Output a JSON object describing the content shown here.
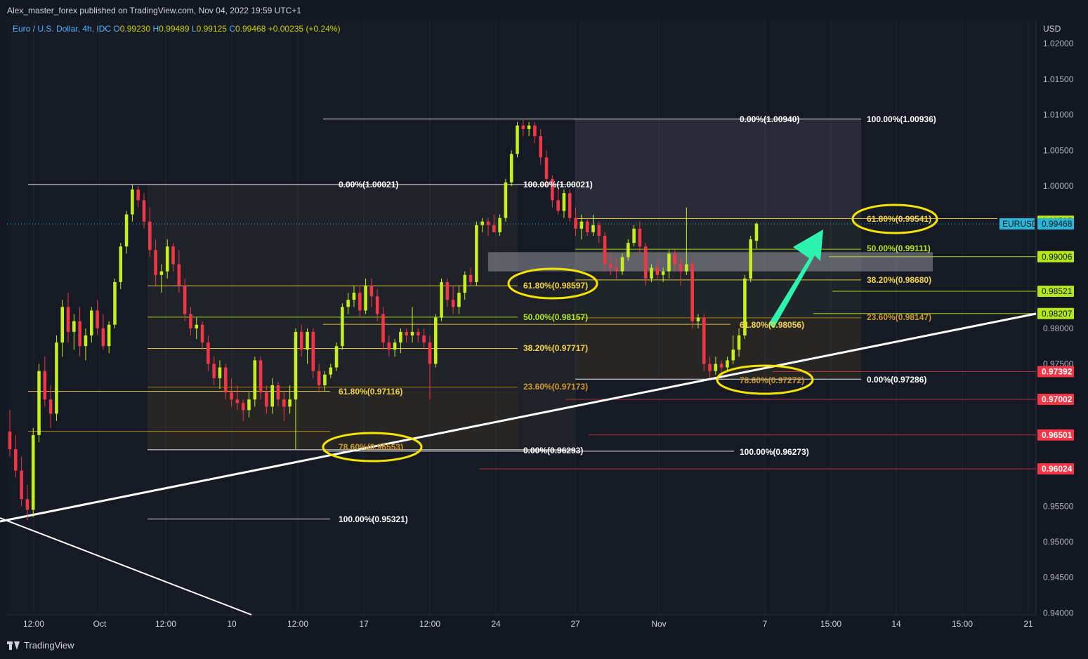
{
  "header": {
    "publisher": "Alex_master_forex published on TradingView.com, Nov 04, 2022 19:59 UTC+1",
    "symbol_desc": "Euro / U.S. Dollar, 4h, IDC",
    "o_label": "O",
    "o_value": "0.99230",
    "h_label": "H",
    "h_value": "0.99489",
    "l_label": "L",
    "l_value": "0.99125",
    "c_label": "C",
    "c_value": "0.99468",
    "change": "+0.00235 (+0.24%)"
  },
  "footer": {
    "brand": "TradingView"
  },
  "colors": {
    "background": "#131722",
    "bull": "#c6ef1f",
    "bear": "#f23645",
    "fib_white": "#ffffff",
    "fib_green": "#b5e61d",
    "fib_yellow": "#f5d442",
    "fib_orange": "#b8860b",
    "ellipse": "#f5e400",
    "arrow": "#2ef2b0",
    "last_price_bg": "#2bb5d6"
  },
  "chart_data": {
    "type": "candlestick",
    "y_axis": {
      "currency": "USD",
      "min": 0.94,
      "max": 1.025,
      "ticks": [
        "1.02000",
        "1.01500",
        "1.01000",
        "1.00500",
        "1.00000",
        "0.98000",
        "0.97500",
        "0.95500",
        "0.95000",
        "0.94500",
        "0.94000"
      ]
    },
    "x_axis": {
      "labels": [
        "12:00",
        "Oct",
        "12:00",
        "10",
        "12:00",
        "17",
        "12:00",
        "24",
        "27",
        "Nov",
        "7",
        "15:00",
        "14",
        "15:00",
        "21"
      ]
    },
    "price_badges": [
      {
        "value": "0.99505",
        "color": "green"
      },
      {
        "value": "0.99468",
        "color": "blue",
        "tag": "EURUSD"
      },
      {
        "value": "0.99006",
        "color": "green"
      },
      {
        "value": "0.98521",
        "color": "green"
      },
      {
        "value": "0.98207",
        "color": "green"
      },
      {
        "value": "0.97392",
        "color": "red"
      },
      {
        "value": "0.97002",
        "color": "red"
      },
      {
        "value": "0.96501",
        "color": "red"
      },
      {
        "value": "0.96024",
        "color": "red"
      }
    ],
    "fib_labels": [
      {
        "text": "0.00%(1.00021)",
        "color": "white"
      },
      {
        "text": "100.00%(1.00021)",
        "color": "white"
      },
      {
        "text": "61.80%(0.97116)",
        "color": "yellow"
      },
      {
        "text": "78.60%(0.96553)",
        "color": "orange"
      },
      {
        "text": "100.00%(0.95321)",
        "color": "white"
      },
      {
        "text": "61.80%(0.98597)",
        "color": "yellow"
      },
      {
        "text": "50.00%(0.98157)",
        "color": "green"
      },
      {
        "text": "38.20%(0.97717)",
        "color": "yellow"
      },
      {
        "text": "23.60%(0.97173)",
        "color": "orange"
      },
      {
        "text": "0.00%(0.96293)",
        "color": "white"
      },
      {
        "text": "0.00%(1.00940)",
        "color": "white"
      },
      {
        "text": "100.00%(1.00936)",
        "color": "white"
      },
      {
        "text": "61.80%(0.99541)",
        "color": "yellow"
      },
      {
        "text": "50.00%(0.99111)",
        "color": "green"
      },
      {
        "text": "38.20%(0.98680)",
        "color": "yellow"
      },
      {
        "text": "23.60%(0.98147)",
        "color": "orange"
      },
      {
        "text": "61.80%(0.98056)",
        "color": "yellow"
      },
      {
        "text": "78.60%(0.97272)",
        "color": "orange"
      },
      {
        "text": "0.00%(0.97286)",
        "color": "white"
      },
      {
        "text": "100.00%(0.96273)",
        "color": "white"
      }
    ],
    "candles": [
      {
        "o": 0.9655,
        "h": 0.9685,
        "l": 0.962,
        "c": 0.963
      },
      {
        "o": 0.963,
        "h": 0.965,
        "l": 0.959,
        "c": 0.96
      },
      {
        "o": 0.96,
        "h": 0.962,
        "l": 0.955,
        "c": 0.956
      },
      {
        "o": 0.956,
        "h": 0.958,
        "l": 0.953,
        "c": 0.9545
      },
      {
        "o": 0.9545,
        "h": 0.966,
        "l": 0.9535,
        "c": 0.965
      },
      {
        "o": 0.965,
        "h": 0.975,
        "l": 0.964,
        "c": 0.974
      },
      {
        "o": 0.974,
        "h": 0.976,
        "l": 0.969,
        "c": 0.97
      },
      {
        "o": 0.97,
        "h": 0.972,
        "l": 0.966,
        "c": 0.968
      },
      {
        "o": 0.968,
        "h": 0.979,
        "l": 0.967,
        "c": 0.978
      },
      {
        "o": 0.978,
        "h": 0.984,
        "l": 0.976,
        "c": 0.983
      },
      {
        "o": 0.983,
        "h": 0.985,
        "l": 0.978,
        "c": 0.9795
      },
      {
        "o": 0.9795,
        "h": 0.982,
        "l": 0.977,
        "c": 0.981
      },
      {
        "o": 0.981,
        "h": 0.983,
        "l": 0.976,
        "c": 0.9775
      },
      {
        "o": 0.9775,
        "h": 0.98,
        "l": 0.9755,
        "c": 0.979
      },
      {
        "o": 0.979,
        "h": 0.983,
        "l": 0.978,
        "c": 0.9825
      },
      {
        "o": 0.9825,
        "h": 0.984,
        "l": 0.979,
        "c": 0.98
      },
      {
        "o": 0.98,
        "h": 0.982,
        "l": 0.977,
        "c": 0.9775
      },
      {
        "o": 0.9775,
        "h": 0.981,
        "l": 0.9765,
        "c": 0.9805
      },
      {
        "o": 0.9805,
        "h": 0.987,
        "l": 0.98,
        "c": 0.9865
      },
      {
        "o": 0.9865,
        "h": 0.992,
        "l": 0.9855,
        "c": 0.9915
      },
      {
        "o": 0.9915,
        "h": 0.9965,
        "l": 0.9905,
        "c": 0.996
      },
      {
        "o": 0.996,
        "h": 1.0002,
        "l": 0.995,
        "c": 0.9995
      },
      {
        "o": 0.9995,
        "h": 1.0,
        "l": 0.997,
        "c": 0.998
      },
      {
        "o": 0.998,
        "h": 0.999,
        "l": 0.994,
        "c": 0.995
      },
      {
        "o": 0.995,
        "h": 0.997,
        "l": 0.99,
        "c": 0.991
      },
      {
        "o": 0.991,
        "h": 0.9925,
        "l": 0.986,
        "c": 0.9875
      },
      {
        "o": 0.9875,
        "h": 0.989,
        "l": 0.985,
        "c": 0.988
      },
      {
        "o": 0.988,
        "h": 0.9925,
        "l": 0.987,
        "c": 0.9915
      },
      {
        "o": 0.9915,
        "h": 0.992,
        "l": 0.988,
        "c": 0.989
      },
      {
        "o": 0.989,
        "h": 0.991,
        "l": 0.985,
        "c": 0.986
      },
      {
        "o": 0.986,
        "h": 0.987,
        "l": 0.981,
        "c": 0.982
      },
      {
        "o": 0.982,
        "h": 0.983,
        "l": 0.979,
        "c": 0.98
      },
      {
        "o": 0.98,
        "h": 0.9815,
        "l": 0.9785,
        "c": 0.9805
      },
      {
        "o": 0.9805,
        "h": 0.981,
        "l": 0.977,
        "c": 0.978
      },
      {
        "o": 0.978,
        "h": 0.979,
        "l": 0.974,
        "c": 0.975
      },
      {
        "o": 0.975,
        "h": 0.976,
        "l": 0.972,
        "c": 0.973
      },
      {
        "o": 0.973,
        "h": 0.9755,
        "l": 0.9715,
        "c": 0.9745
      },
      {
        "o": 0.9745,
        "h": 0.975,
        "l": 0.97,
        "c": 0.971
      },
      {
        "o": 0.971,
        "h": 0.973,
        "l": 0.969,
        "c": 0.97
      },
      {
        "o": 0.97,
        "h": 0.972,
        "l": 0.9685,
        "c": 0.9695
      },
      {
        "o": 0.9695,
        "h": 0.97,
        "l": 0.967,
        "c": 0.9685
      },
      {
        "o": 0.9685,
        "h": 0.971,
        "l": 0.9675,
        "c": 0.97
      },
      {
        "o": 0.97,
        "h": 0.976,
        "l": 0.969,
        "c": 0.9755
      },
      {
        "o": 0.9755,
        "h": 0.976,
        "l": 0.97,
        "c": 0.971
      },
      {
        "o": 0.971,
        "h": 0.972,
        "l": 0.968,
        "c": 0.969
      },
      {
        "o": 0.969,
        "h": 0.973,
        "l": 0.968,
        "c": 0.972
      },
      {
        "o": 0.972,
        "h": 0.9725,
        "l": 0.969,
        "c": 0.97
      },
      {
        "o": 0.97,
        "h": 0.971,
        "l": 0.967,
        "c": 0.969
      },
      {
        "o": 0.969,
        "h": 0.972,
        "l": 0.968,
        "c": 0.97
      },
      {
        "o": 0.97,
        "h": 0.98,
        "l": 0.963,
        "c": 0.9795
      },
      {
        "o": 0.9795,
        "h": 0.9805,
        "l": 0.976,
        "c": 0.977
      },
      {
        "o": 0.977,
        "h": 0.98,
        "l": 0.975,
        "c": 0.9795
      },
      {
        "o": 0.9795,
        "h": 0.98,
        "l": 0.973,
        "c": 0.974
      },
      {
        "o": 0.974,
        "h": 0.975,
        "l": 0.971,
        "c": 0.972
      },
      {
        "o": 0.972,
        "h": 0.974,
        "l": 0.9712,
        "c": 0.9735
      },
      {
        "o": 0.9735,
        "h": 0.975,
        "l": 0.973,
        "c": 0.9745
      },
      {
        "o": 0.9745,
        "h": 0.978,
        "l": 0.974,
        "c": 0.9775
      },
      {
        "o": 0.9775,
        "h": 0.9835,
        "l": 0.977,
        "c": 0.983
      },
      {
        "o": 0.983,
        "h": 0.985,
        "l": 0.982,
        "c": 0.984
      },
      {
        "o": 0.984,
        "h": 0.986,
        "l": 0.983,
        "c": 0.985
      },
      {
        "o": 0.985,
        "h": 0.986,
        "l": 0.9815,
        "c": 0.9825
      },
      {
        "o": 0.9825,
        "h": 0.987,
        "l": 0.982,
        "c": 0.986
      },
      {
        "o": 0.986,
        "h": 0.987,
        "l": 0.983,
        "c": 0.9845
      },
      {
        "o": 0.9845,
        "h": 0.9855,
        "l": 0.981,
        "c": 0.982
      },
      {
        "o": 0.982,
        "h": 0.983,
        "l": 0.977,
        "c": 0.978
      },
      {
        "o": 0.978,
        "h": 0.979,
        "l": 0.976,
        "c": 0.977
      },
      {
        "o": 0.977,
        "h": 0.9785,
        "l": 0.976,
        "c": 0.978
      },
      {
        "o": 0.978,
        "h": 0.98,
        "l": 0.9765,
        "c": 0.9795
      },
      {
        "o": 0.9795,
        "h": 0.98,
        "l": 0.978,
        "c": 0.979
      },
      {
        "o": 0.979,
        "h": 0.983,
        "l": 0.978,
        "c": 0.9795
      },
      {
        "o": 0.9795,
        "h": 0.98,
        "l": 0.978,
        "c": 0.979
      },
      {
        "o": 0.979,
        "h": 0.98,
        "l": 0.977,
        "c": 0.978
      },
      {
        "o": 0.978,
        "h": 0.979,
        "l": 0.97,
        "c": 0.975
      },
      {
        "o": 0.975,
        "h": 0.982,
        "l": 0.9745,
        "c": 0.9815
      },
      {
        "o": 0.9815,
        "h": 0.987,
        "l": 0.981,
        "c": 0.9865
      },
      {
        "o": 0.9865,
        "h": 0.987,
        "l": 0.983,
        "c": 0.984
      },
      {
        "o": 0.984,
        "h": 0.986,
        "l": 0.982,
        "c": 0.983
      },
      {
        "o": 0.983,
        "h": 0.986,
        "l": 0.982,
        "c": 0.985
      },
      {
        "o": 0.985,
        "h": 0.988,
        "l": 0.984,
        "c": 0.9875
      },
      {
        "o": 0.9875,
        "h": 0.9885,
        "l": 0.986,
        "c": 0.9865
      },
      {
        "o": 0.9865,
        "h": 0.995,
        "l": 0.986,
        "c": 0.9945
      },
      {
        "o": 0.9945,
        "h": 0.9955,
        "l": 0.9935,
        "c": 0.995
      },
      {
        "o": 0.995,
        "h": 0.9955,
        "l": 0.993,
        "c": 0.9945
      },
      {
        "o": 0.9945,
        "h": 0.996,
        "l": 0.9935,
        "c": 0.9935
      },
      {
        "o": 0.9935,
        "h": 0.996,
        "l": 0.993,
        "c": 0.9955
      },
      {
        "o": 0.9955,
        "h": 1.001,
        "l": 0.995,
        "c": 1.0005
      },
      {
        "o": 1.0005,
        "h": 1.005,
        "l": 1.0,
        "c": 1.0045
      },
      {
        "o": 1.0045,
        "h": 1.009,
        "l": 1.004,
        "c": 1.0085
      },
      {
        "o": 1.0085,
        "h": 1.0094,
        "l": 1.007,
        "c": 1.008
      },
      {
        "o": 1.008,
        "h": 1.009,
        "l": 1.007,
        "c": 1.0085
      },
      {
        "o": 1.0085,
        "h": 1.009,
        "l": 1.006,
        "c": 1.007
      },
      {
        "o": 1.007,
        "h": 1.008,
        "l": 1.003,
        "c": 1.004
      },
      {
        "o": 1.004,
        "h": 1.005,
        "l": 1.0,
        "c": 1.001
      },
      {
        "o": 1.001,
        "h": 1.0015,
        "l": 0.997,
        "c": 0.998
      },
      {
        "o": 0.998,
        "h": 0.9995,
        "l": 0.996,
        "c": 0.9965
      },
      {
        "o": 0.9965,
        "h": 0.9995,
        "l": 0.9955,
        "c": 0.999
      },
      {
        "o": 0.999,
        "h": 0.9995,
        "l": 0.995,
        "c": 0.9955
      },
      {
        "o": 0.9955,
        "h": 0.997,
        "l": 0.993,
        "c": 0.994
      },
      {
        "o": 0.994,
        "h": 0.996,
        "l": 0.9925,
        "c": 0.995
      },
      {
        "o": 0.995,
        "h": 0.9955,
        "l": 0.993,
        "c": 0.9935
      },
      {
        "o": 0.9935,
        "h": 0.996,
        "l": 0.993,
        "c": 0.9945
      },
      {
        "o": 0.9945,
        "h": 0.995,
        "l": 0.992,
        "c": 0.993
      },
      {
        "o": 0.993,
        "h": 0.9935,
        "l": 0.988,
        "c": 0.989
      },
      {
        "o": 0.989,
        "h": 0.9905,
        "l": 0.9875,
        "c": 0.9885
      },
      {
        "o": 0.9885,
        "h": 0.99,
        "l": 0.987,
        "c": 0.988
      },
      {
        "o": 0.988,
        "h": 0.9905,
        "l": 0.9875,
        "c": 0.99
      },
      {
        "o": 0.99,
        "h": 0.9925,
        "l": 0.9895,
        "c": 0.992
      },
      {
        "o": 0.992,
        "h": 0.9945,
        "l": 0.9915,
        "c": 0.994
      },
      {
        "o": 0.994,
        "h": 0.995,
        "l": 0.9905,
        "c": 0.9915
      },
      {
        "o": 0.9915,
        "h": 0.992,
        "l": 0.986,
        "c": 0.987
      },
      {
        "o": 0.987,
        "h": 0.989,
        "l": 0.9865,
        "c": 0.9885
      },
      {
        "o": 0.9885,
        "h": 0.9895,
        "l": 0.987,
        "c": 0.9875
      },
      {
        "o": 0.9875,
        "h": 0.9885,
        "l": 0.9865,
        "c": 0.988
      },
      {
        "o": 0.988,
        "h": 0.991,
        "l": 0.987,
        "c": 0.9905
      },
      {
        "o": 0.9905,
        "h": 0.991,
        "l": 0.988,
        "c": 0.989
      },
      {
        "o": 0.989,
        "h": 0.99,
        "l": 0.986,
        "c": 0.988
      },
      {
        "o": 0.988,
        "h": 0.997,
        "l": 0.9875,
        "c": 0.989
      },
      {
        "o": 0.989,
        "h": 0.9895,
        "l": 0.98,
        "c": 0.981
      },
      {
        "o": 0.981,
        "h": 0.982,
        "l": 0.98,
        "c": 0.9815
      },
      {
        "o": 0.9815,
        "h": 0.982,
        "l": 0.974,
        "c": 0.975
      },
      {
        "o": 0.975,
        "h": 0.976,
        "l": 0.973,
        "c": 0.974
      },
      {
        "o": 0.974,
        "h": 0.976,
        "l": 0.9735,
        "c": 0.975
      },
      {
        "o": 0.975,
        "h": 0.9755,
        "l": 0.9735,
        "c": 0.9745
      },
      {
        "o": 0.9745,
        "h": 0.976,
        "l": 0.974,
        "c": 0.9755
      },
      {
        "o": 0.9755,
        "h": 0.979,
        "l": 0.975,
        "c": 0.977
      },
      {
        "o": 0.977,
        "h": 0.98,
        "l": 0.976,
        "c": 0.979
      },
      {
        "o": 0.979,
        "h": 0.9875,
        "l": 0.9785,
        "c": 0.987
      },
      {
        "o": 0.987,
        "h": 0.993,
        "l": 0.9865,
        "c": 0.9925
      },
      {
        "o": 0.9923,
        "h": 0.9949,
        "l": 0.9912,
        "c": 0.9947
      }
    ]
  }
}
